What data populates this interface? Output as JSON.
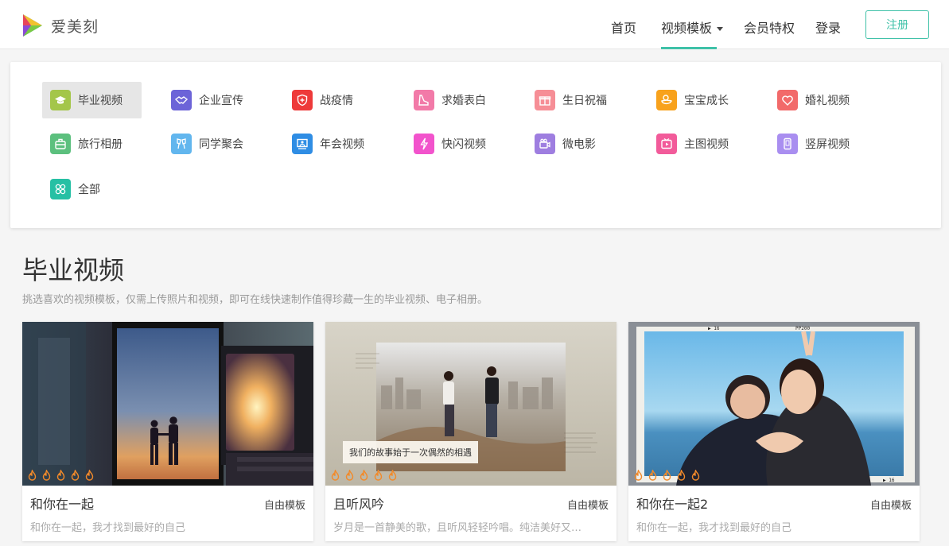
{
  "header": {
    "logo_text": "爱美刻",
    "nav": [
      {
        "label": "首页"
      },
      {
        "label": "视频模板"
      },
      {
        "label": "会员特权"
      },
      {
        "label": "登录"
      }
    ],
    "signup_label": "注册",
    "accent_color": "#3fc1a8"
  },
  "categories": [
    {
      "label": "毕业视频",
      "icon": "graduation-cap-icon",
      "color": "#a4c64a"
    },
    {
      "label": "企业宣传",
      "icon": "handshake-icon",
      "color": "#6c64d8"
    },
    {
      "label": "战疫情",
      "icon": "shield-icon",
      "color": "#ee3a3a"
    },
    {
      "label": "求婚表白",
      "icon": "shoe-icon",
      "color": "#f27aa8"
    },
    {
      "label": "生日祝福",
      "icon": "gift-icon",
      "color": "#f68e96"
    },
    {
      "label": "宝宝成长",
      "icon": "duck-icon",
      "color": "#f8a21c"
    },
    {
      "label": "婚礼视频",
      "icon": "heart-icon",
      "color": "#f26a6a"
    },
    {
      "label": "旅行相册",
      "icon": "luggage-icon",
      "color": "#5cc07e"
    },
    {
      "label": "同学聚会",
      "icon": "cheers-icon",
      "color": "#62b6ee"
    },
    {
      "label": "年会视频",
      "icon": "presentation-icon",
      "color": "#2f8de4"
    },
    {
      "label": "快闪视频",
      "icon": "lightning-icon",
      "color": "#f253cc"
    },
    {
      "label": "微电影",
      "icon": "camera-icon",
      "color": "#9e7ee0"
    },
    {
      "label": "主图视频",
      "icon": "tv-play-icon",
      "color": "#f25b9a"
    },
    {
      "label": "竖屏视频",
      "icon": "phone-icon",
      "color": "#a98ef0"
    },
    {
      "label": "全部",
      "icon": "four-circles-icon",
      "color": "#26c0a4"
    }
  ],
  "section": {
    "title": "毕业视频",
    "description": "挑选喜欢的视频模板，仅需上传照片和视频，即可在线快速制作值得珍藏一生的毕业视频、电子相册。"
  },
  "cards": [
    {
      "title": "和你在一起",
      "tag": "自由模板",
      "desc": "和你在一起，我才找到最好的自己",
      "caption": ""
    },
    {
      "title": "且听风吟",
      "tag": "自由模板",
      "desc": "岁月是一首静美的歌，且听风轻轻吟唱。纯洁美好又…",
      "caption": "我们的故事始于一次偶然的相遇"
    },
    {
      "title": "和你在一起2",
      "tag": "自由模板",
      "desc": "和你在一起，我才找到最好的自己",
      "caption": ""
    }
  ]
}
